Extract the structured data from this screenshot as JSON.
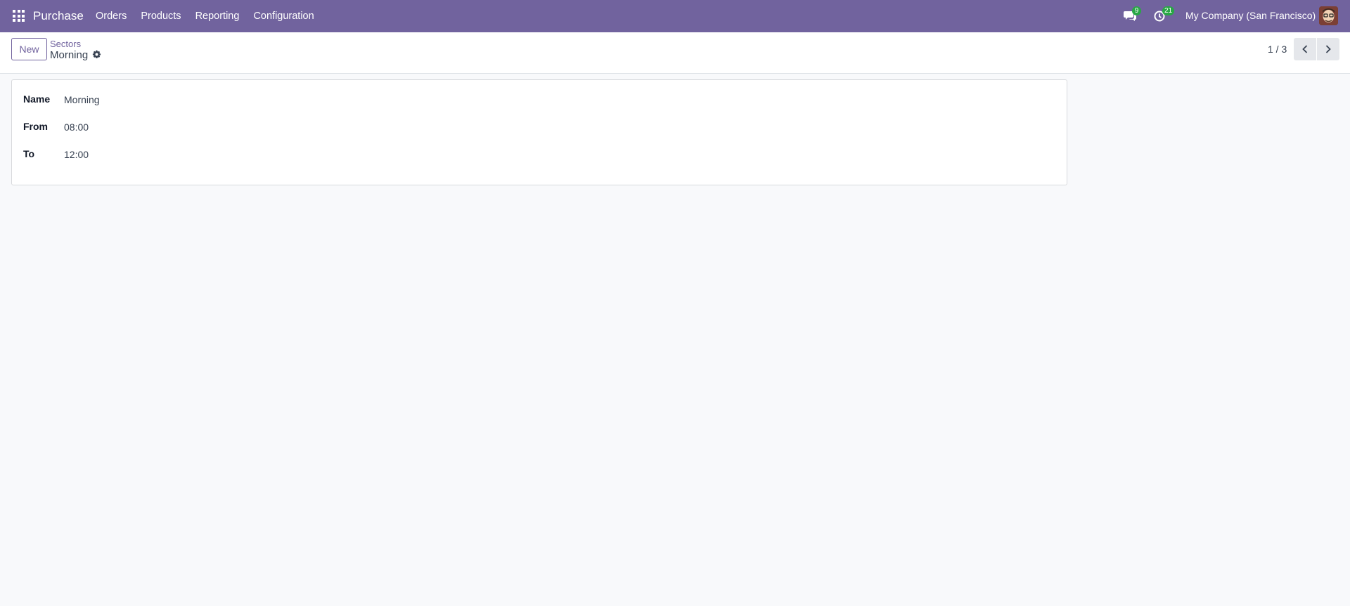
{
  "navbar": {
    "app_name": "Purchase",
    "menu": [
      "Orders",
      "Products",
      "Reporting",
      "Configuration"
    ],
    "messages_count": "9",
    "activities_count": "21",
    "company": "My Company (San Francisco)",
    "bg_color": "#71639e"
  },
  "control_panel": {
    "new_label": "New",
    "breadcrumb_parent": "Sectors",
    "breadcrumb_current": "Morning",
    "pager_value": "1 / 3"
  },
  "form": {
    "fields": [
      {
        "label": "Name",
        "value": "Morning"
      },
      {
        "label": "From",
        "value": "08:00"
      },
      {
        "label": "To",
        "value": "12:00"
      }
    ]
  }
}
